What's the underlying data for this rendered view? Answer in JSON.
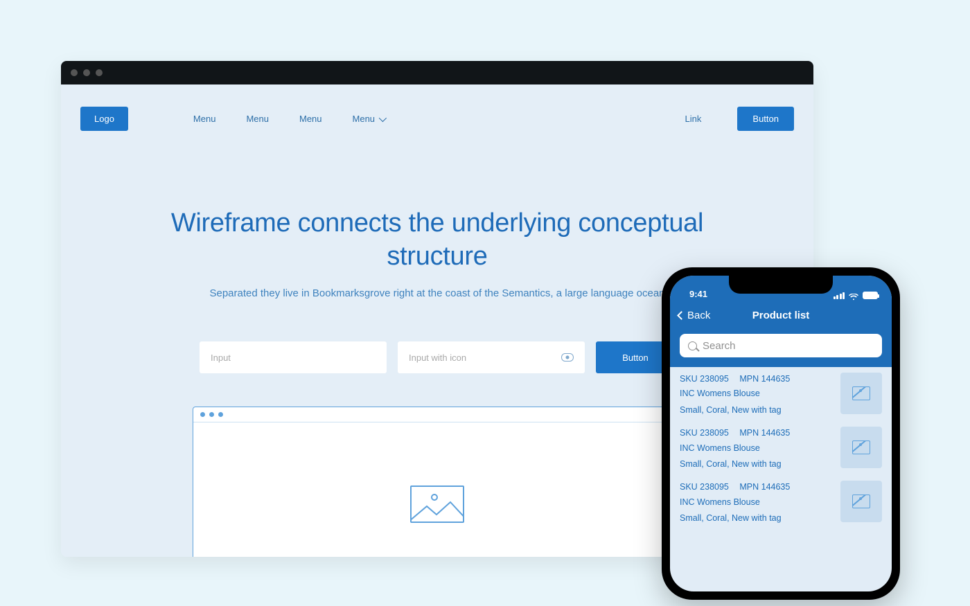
{
  "desktop": {
    "logo": "Logo",
    "menu": [
      "Menu",
      "Menu",
      "Menu",
      "Menu"
    ],
    "link": "Link",
    "button": "Button",
    "heading": "Wireframe connects the underlying conceptual structure",
    "subtitle": "Separated they live in Bookmarksgrove right at the coast of the Semantics, a large language ocean",
    "input1_placeholder": "Input",
    "input2_placeholder": "Input with icon",
    "form_button": "Button"
  },
  "phone": {
    "time": "9:41",
    "back": "Back",
    "title": "Product list",
    "search_placeholder": "Search",
    "products": [
      {
        "sku": "SKU 238095",
        "mpn": "MPN 144635",
        "name": "INC Womens Blouse",
        "attrs": "Small, Coral, New with tag"
      },
      {
        "sku": "SKU 238095",
        "mpn": "MPN 144635",
        "name": "INC Womens Blouse",
        "attrs": "Small, Coral, New with tag"
      },
      {
        "sku": "SKU 238095",
        "mpn": "MPN 144635",
        "name": "INC Womens Blouse",
        "attrs": "Small, Coral, New with tag"
      }
    ]
  }
}
